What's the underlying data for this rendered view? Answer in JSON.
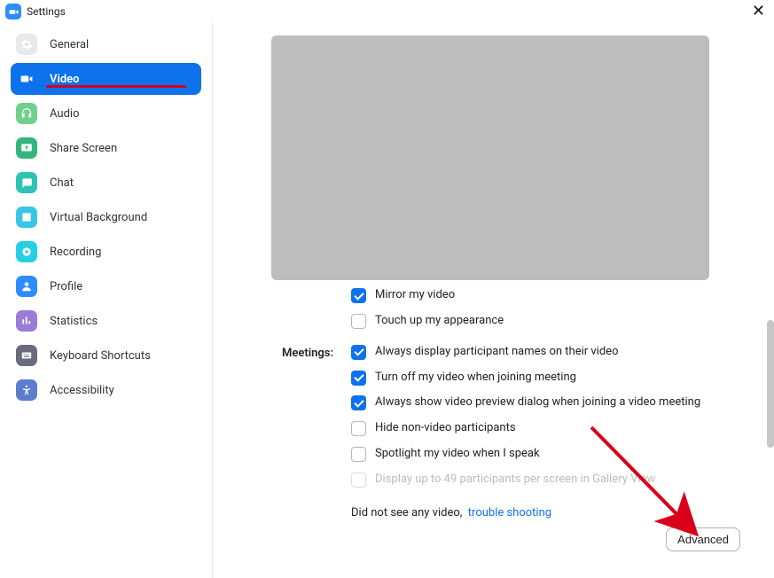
{
  "window": {
    "title": "Settings"
  },
  "sidebar": {
    "items": [
      {
        "label": "General"
      },
      {
        "label": "Video"
      },
      {
        "label": "Audio"
      },
      {
        "label": "Share Screen"
      },
      {
        "label": "Chat"
      },
      {
        "label": "Virtual Background"
      },
      {
        "label": "Recording"
      },
      {
        "label": "Profile"
      },
      {
        "label": "Statistics"
      },
      {
        "label": "Keyboard Shortcuts"
      },
      {
        "label": "Accessibility"
      }
    ],
    "active_index": 1
  },
  "video_settings": {
    "my_video": {
      "mirror": {
        "label": "Mirror my video",
        "checked": true
      },
      "touch_up": {
        "label": "Touch up my appearance",
        "checked": false
      }
    },
    "meetings_label": "Meetings:",
    "meetings": {
      "display_names": {
        "label": "Always display participant names on their video",
        "checked": true
      },
      "turn_off_join": {
        "label": "Turn off my video when joining meeting",
        "checked": true
      },
      "show_preview": {
        "label": "Always show video preview dialog when joining a video meeting",
        "checked": true
      },
      "hide_nonvideo": {
        "label": "Hide non-video participants",
        "checked": false
      },
      "spotlight": {
        "label": "Spotlight my video when I speak",
        "checked": false
      },
      "gallery49": {
        "label": "Display up to 49 participants per screen in Gallery View",
        "checked": false,
        "disabled": true
      }
    },
    "no_video_text": "Did not see any video,",
    "trouble_link": "trouble shooting",
    "advanced_button": "Advanced"
  },
  "colors": {
    "accent": "#0e72ed",
    "annotation": "#d9001b"
  }
}
